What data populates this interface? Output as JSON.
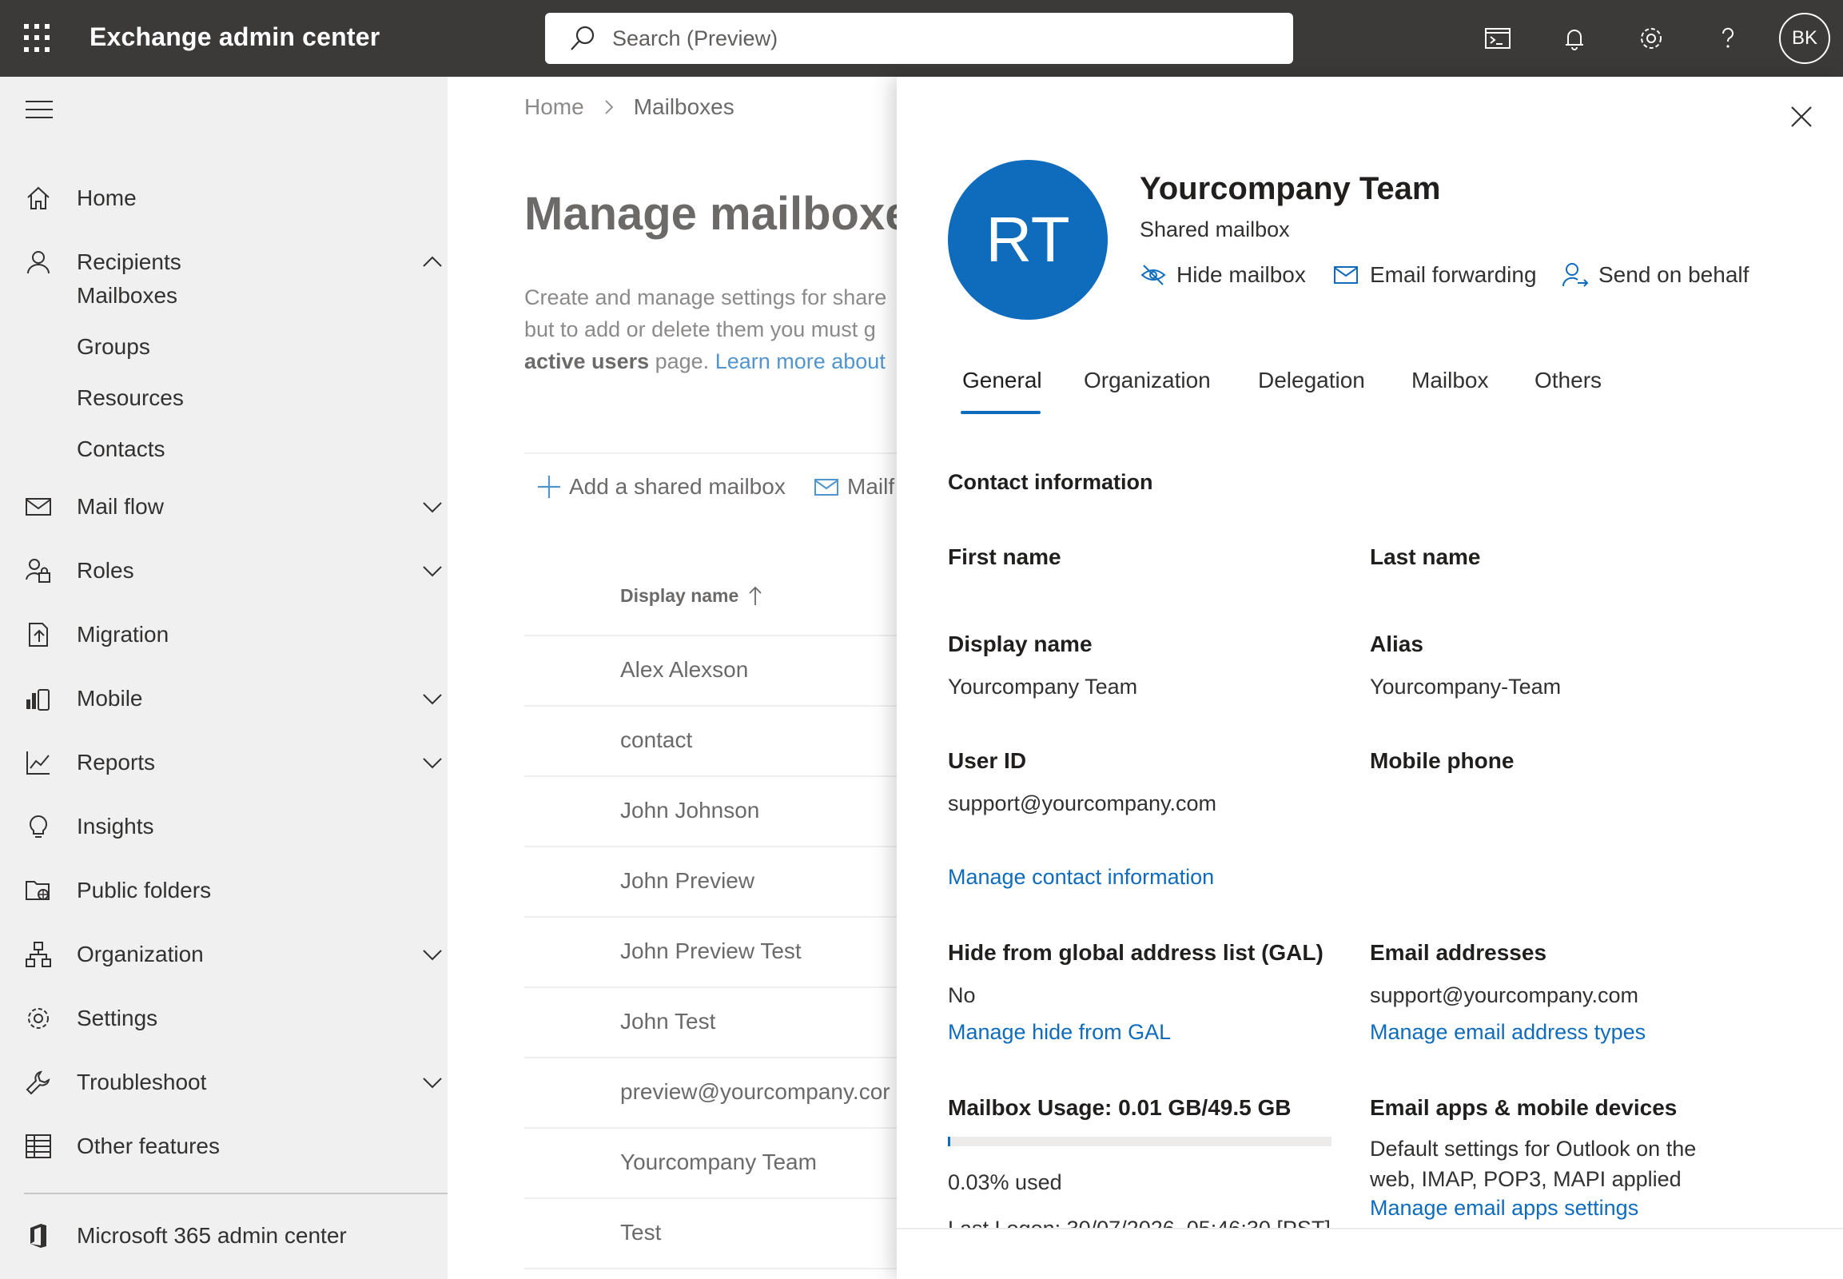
{
  "topbar": {
    "app_title": "Exchange admin center",
    "search_placeholder": "Search (Preview)",
    "icons": [
      "cloud-shell-icon",
      "bell-icon",
      "gear-icon",
      "help-icon"
    ],
    "avatar_initials": "BK"
  },
  "sidebar": {
    "items": [
      {
        "label": "Home",
        "icon": "home-icon"
      },
      {
        "label": "Recipients",
        "icon": "person-icon",
        "expanded": true
      },
      {
        "label": "Mail flow",
        "icon": "mail-icon",
        "expandable": true
      },
      {
        "label": "Roles",
        "icon": "roles-icon",
        "expandable": true
      },
      {
        "label": "Migration",
        "icon": "migration-icon"
      },
      {
        "label": "Mobile",
        "icon": "mobile-icon",
        "expandable": true
      },
      {
        "label": "Reports",
        "icon": "chart-icon",
        "expandable": true
      },
      {
        "label": "Insights",
        "icon": "lightbulb-icon"
      },
      {
        "label": "Public folders",
        "icon": "folder-icon"
      },
      {
        "label": "Organization",
        "icon": "org-icon",
        "expandable": true
      },
      {
        "label": "Settings",
        "icon": "gear-icon"
      },
      {
        "label": "Troubleshoot",
        "icon": "wrench-icon",
        "expandable": true
      },
      {
        "label": "Other features",
        "icon": "grid-icon"
      }
    ],
    "recipients_sub": [
      "Mailboxes",
      "Groups",
      "Resources",
      "Contacts"
    ],
    "footer_item": {
      "label": "Microsoft 365 admin center",
      "icon": "office-icon"
    }
  },
  "main": {
    "breadcrumb": {
      "home": "Home",
      "current": "Mailboxes"
    },
    "title": "Manage mailboxe",
    "description": {
      "line1": "Create and manage settings for share",
      "line2": "but to add or delete them you must g",
      "line3_bold": "active users",
      "line3_text": " page. ",
      "line3_link": "Learn more about"
    },
    "commands": {
      "add_shared": "Add a shared mailbox",
      "mailflow": "Mailf"
    },
    "column_header": "Display name",
    "rows": [
      "Alex Alexson",
      "contact",
      "John Johnson",
      "John Preview",
      "John Preview Test",
      "John Test",
      "preview@yourcompany.cor",
      "Yourcompany Team",
      "Test"
    ]
  },
  "panel": {
    "avatar_initials": "RT",
    "avatar_color": "#0f6cbd",
    "name": "Yourcompany Team",
    "type": "Shared mailbox",
    "actions": {
      "hide": "Hide mailbox",
      "forwarding": "Email forwarding",
      "send_on_behalf": "Send on behalf"
    },
    "tabs": [
      "General",
      "Organization",
      "Delegation",
      "Mailbox",
      "Others"
    ],
    "active_tab": "General",
    "section_title": "Contact information",
    "fields": {
      "first_name_label": "First name",
      "last_name_label": "Last name",
      "display_name_label": "Display name",
      "display_name_value": "Yourcompany Team",
      "alias_label": "Alias",
      "alias_value": "Yourcompany-Team",
      "user_id_label": "User ID",
      "user_id_value": "support@yourcompany.com",
      "mobile_label": "Mobile phone",
      "manage_contact_link": "Manage contact information",
      "gal_label": "Hide from global address list (GAL)",
      "gal_value": "No",
      "gal_link": "Manage hide from GAL",
      "email_addresses_label": "Email addresses",
      "email_addresses_value": "support@yourcompany.com",
      "email_addresses_link": "Manage email address types",
      "usage_label": "Mailbox Usage: 0.01 GB/49.5 GB",
      "usage_percent": 0.03,
      "usage_text": "0.03% used",
      "last_logon_partial": "Last Logon: 30/07/2026, 05:46:30 [PST]",
      "email_apps_label": "Email apps & mobile devices",
      "email_apps_line1": "Default settings for Outlook on the",
      "email_apps_line2": "web, IMAP, POP3, MAPI applied",
      "email_apps_link": "Manage email apps settings"
    }
  },
  "colors": {
    "topbar": "#3b3a39",
    "accent": "#0f6cbd",
    "sidebar": "#f0f0f0"
  }
}
